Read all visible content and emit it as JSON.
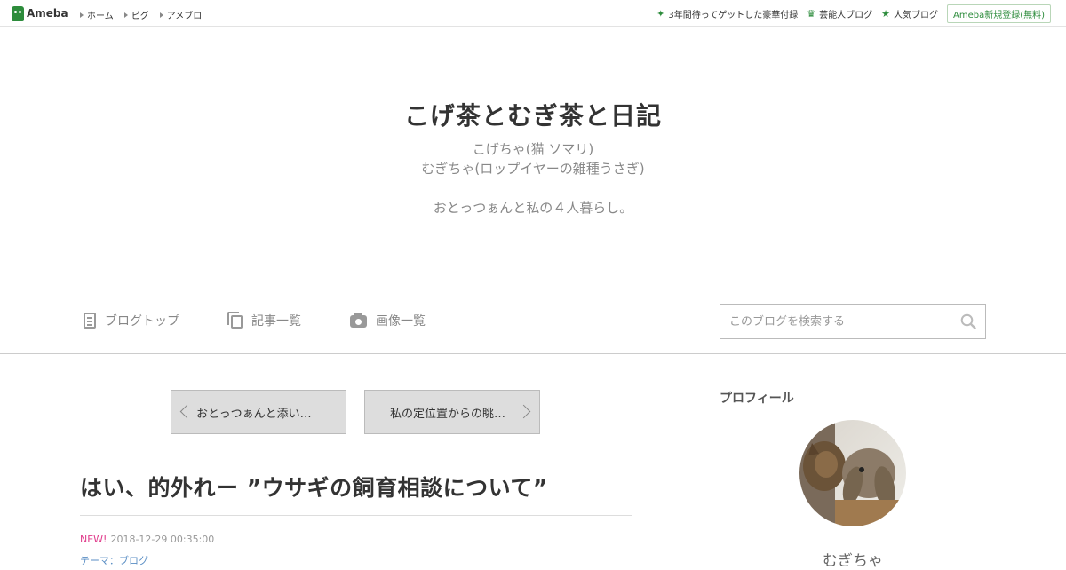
{
  "topbar": {
    "logo_text": "Ameba",
    "nav": [
      "ホーム",
      "ピグ",
      "アメブロ"
    ],
    "links": [
      {
        "label": "3年間待ってゲットした豪華付録",
        "icon": "sparkle-icon"
      },
      {
        "label": "芸能人ブログ",
        "icon": "crown-icon"
      },
      {
        "label": "人気ブログ",
        "icon": "star-icon"
      }
    ],
    "register_label": "Ameba新規登録(無料)"
  },
  "header": {
    "title": "こげ茶とむぎ茶と日記",
    "desc_line1": "こげちゃ(猫 ソマリ)",
    "desc_line2": "むぎちゃ(ロップイヤーの雑種うさぎ)",
    "desc_line3": "おとっつぁんと私の４人暮らし。"
  },
  "nav": {
    "top": "ブログトップ",
    "list": "記事一覧",
    "images": "画像一覧",
    "search_placeholder": "このブログを検索する"
  },
  "pager": {
    "prev": "おとっつぁんと添い…",
    "next": "私の定位置からの眺…"
  },
  "entry": {
    "title": "はい、的外れー ”ウサギの飼育相談について”",
    "new_badge": "NEW!",
    "date": "2018-12-29 00:35:00",
    "theme": "テーマ：ブログ"
  },
  "sidebar": {
    "heading": "プロフィール",
    "nickname": "むぎちゃ"
  },
  "colors": {
    "brand_green": "#2d8c3c",
    "new_pink": "#e03b8b",
    "link_blue": "#5a8ec4"
  }
}
